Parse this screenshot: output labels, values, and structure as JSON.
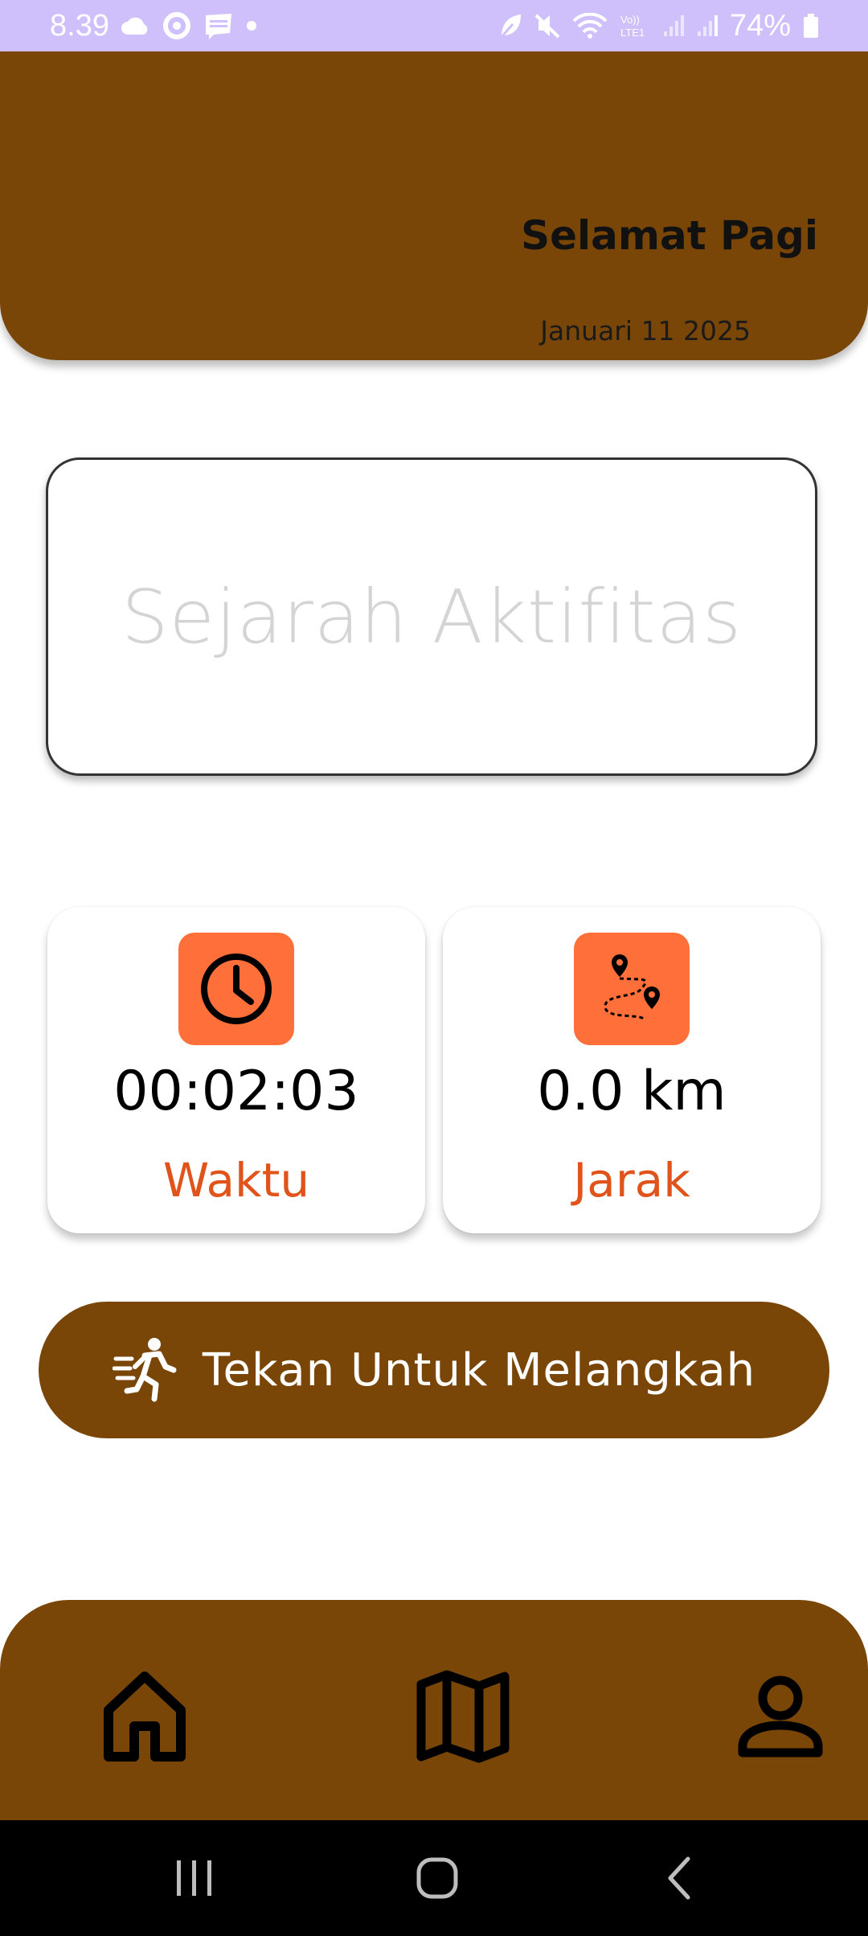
{
  "status_bar": {
    "time": "8.39",
    "left_icons": [
      "cloud-icon",
      "location-ring-icon",
      "webtoon-icon",
      "dot-icon"
    ],
    "right_icons": [
      "leaf-icon",
      "mute-icon",
      "wifi-icon",
      "volte-icon",
      "signal-icon",
      "signal-icon",
      "battery-icon"
    ],
    "volte_label": "Vo)) LTE1",
    "battery": "74%"
  },
  "header": {
    "greeting": "Selamat Pagi",
    "date": "Januari 11 2025",
    "background_color": "#7a4608"
  },
  "history_card": {
    "label": "Sejarah Aktifitas"
  },
  "stats": {
    "time": {
      "icon": "clock-icon",
      "value": "00:02:03",
      "label": "Waktu"
    },
    "distance": {
      "icon": "route-map-icon",
      "value": "0.0 km",
      "label": "Jarak"
    },
    "icon_bg_color": "#ff6f3a",
    "label_color": "#e0541c"
  },
  "start_button": {
    "icon": "running-person-icon",
    "label": "Tekan Untuk Melangkah"
  },
  "bottom_nav": {
    "items": [
      {
        "name": "home",
        "icon": "home-icon"
      },
      {
        "name": "map",
        "icon": "map-icon"
      },
      {
        "name": "profile",
        "icon": "profile-icon"
      }
    ]
  },
  "system_nav": {
    "buttons": [
      "recents-icon",
      "home-circle-icon",
      "back-icon"
    ]
  }
}
